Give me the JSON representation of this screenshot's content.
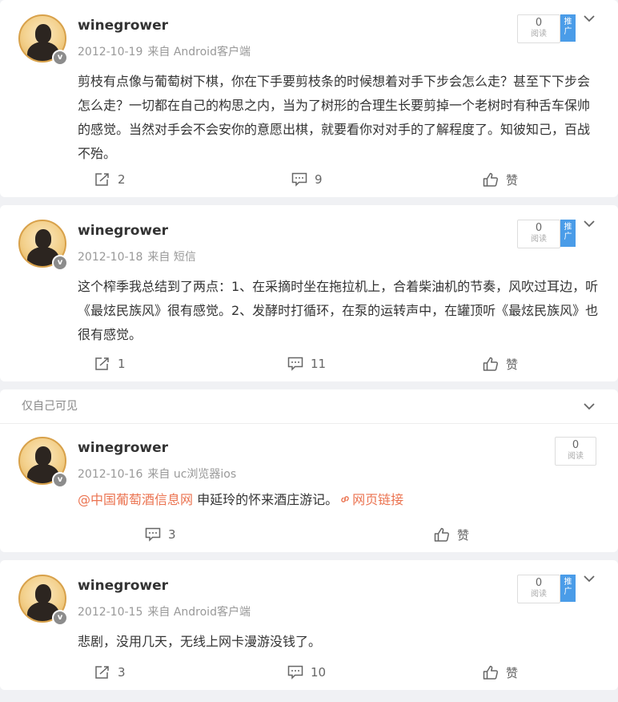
{
  "read_label": "阅读",
  "promo_label": "推广",
  "posts": [
    {
      "username": "winegrower",
      "date": "2012-10-19",
      "source": "来自 Android客户端",
      "text": "剪枝有点像与葡萄树下棋，你在下手要剪枝条的时候想着对手下步会怎么走？甚至下下步会怎么走？一切都在自己的构思之内，当为了树形的合理生长要剪掉一个老树时有种舌车保帅的感觉。当然对手会不会安你的意愿出棋，就要看你对对手的了解程度了。知彼知己，百战不殆。",
      "reads": "0",
      "reposts": "2",
      "comments": "9",
      "likes": "赞"
    },
    {
      "username": "winegrower",
      "date": "2012-10-18",
      "source": "来自 短信",
      "text": "这个榨季我总结到了两点：1、在采摘时坐在拖拉机上，合着柴油机的节奏，风吹过耳边，听《最炫民族风》很有感觉。2、发酵时打循环，在泵的运转声中，在罐顶听《最炫民族风》也很有感觉。",
      "reads": "0",
      "reposts": "1",
      "comments": "11",
      "likes": "赞"
    },
    {
      "private_label": "仅自己可见",
      "username": "winegrower",
      "date": "2012-10-16",
      "source": "来自 uc浏览器ios",
      "mention": "@中国葡萄酒信息网",
      "text": " 申延玲的怀来酒庄游记。",
      "web_link": "网页链接",
      "reads": "0",
      "comments": "3",
      "likes": "赞"
    },
    {
      "username": "winegrower",
      "date": "2012-10-15",
      "source": "来自 Android客户端",
      "text": "悲剧，没用几天，无线上网卡漫游没钱了。",
      "reads": "0",
      "reposts": "3",
      "comments": "10",
      "likes": "赞"
    }
  ]
}
